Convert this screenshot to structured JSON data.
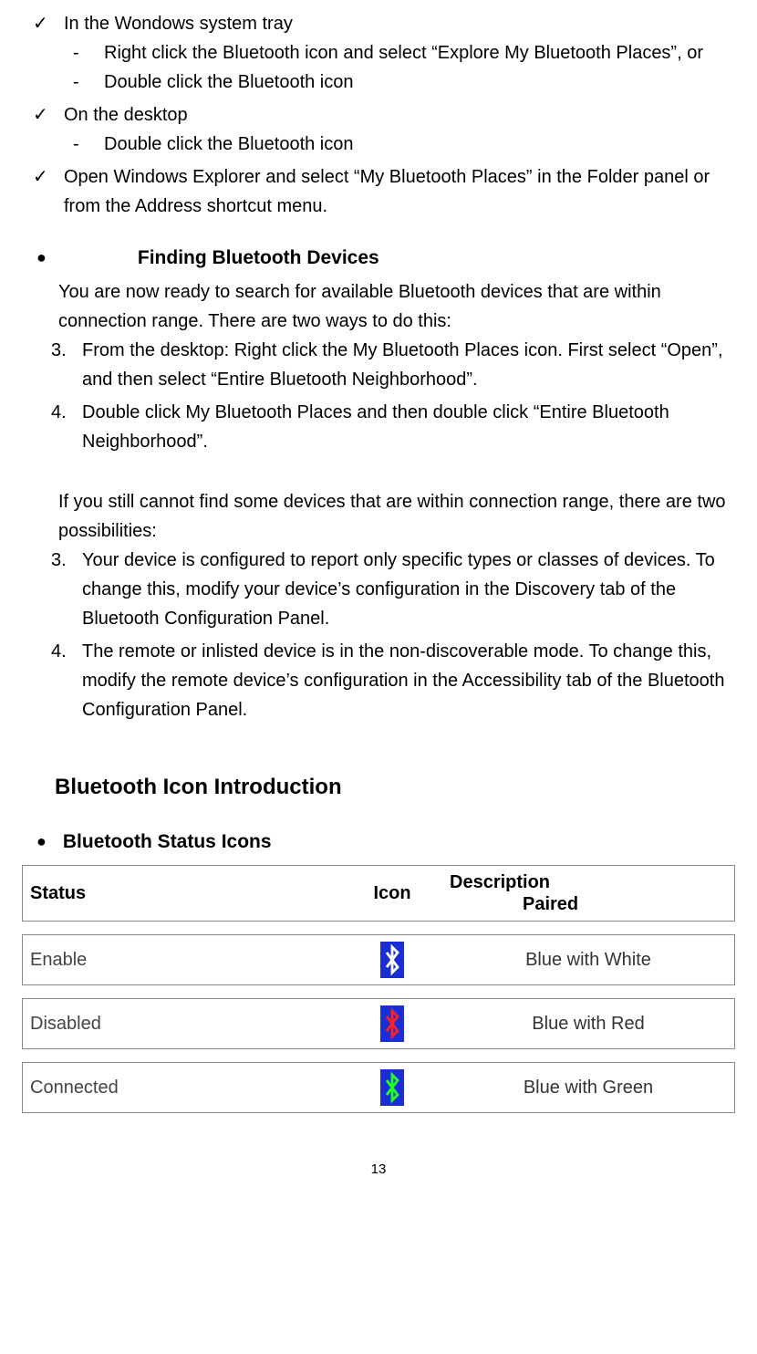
{
  "content": {
    "tray_title": "In the Wondows system tray",
    "tray_a": "Right click the Bluetooth icon and select “Explore My Bluetooth Places”, or",
    "tray_b": "Double click the Bluetooth icon",
    "desktop_title": "On the desktop",
    "desktop_a": "Double click the Bluetooth icon",
    "explorer": "Open Windows Explorer and select “My Bluetooth Places” in the Folder panel or from the Address shortcut menu.",
    "finding_heading": "Finding Bluetooth Devices",
    "finding_intro": "You are now ready to search for available Bluetooth devices that are within connection range.  There are two ways to do this:",
    "find_3": "From the desktop: Right click the My Bluetooth Places icon.  First select “Open”, and then select “Entire Bluetooth Neighborhood”.",
    "find_4": "Double click My Bluetooth Places and then double click “Entire Bluetooth Neighborhood”.",
    "cannot_find": "If you still cannot find some devices that are within connection range, there are two possibilities:",
    "poss_3": "Your device is configured to report only specific types or classes of devices.   To change this, modify your device’s configuration in the Discovery tab of the Bluetooth Configuration Panel.",
    "poss_4": "The remote or inlisted device is in the non-discoverable mode.   To change this, modify the remote device’s configuration in the Accessibility tab of the Bluetooth Configuration Panel.",
    "section_title": "Bluetooth Icon Introduction",
    "status_icons_heading": "Bluetooth Status Icons"
  },
  "table": {
    "header": {
      "status": "Status",
      "icon": "Icon",
      "desc1": "Description",
      "desc2": "Paired"
    },
    "rows": [
      {
        "status": "Enable",
        "desc": "Blue with White",
        "iconFg": "#ffffff"
      },
      {
        "status": "Disabled",
        "desc": "Blue with Red",
        "iconFg": "#ff2020"
      },
      {
        "status": "Connected",
        "desc": "Blue with Green",
        "iconFg": "#20ff20"
      }
    ]
  },
  "page_number": "13"
}
